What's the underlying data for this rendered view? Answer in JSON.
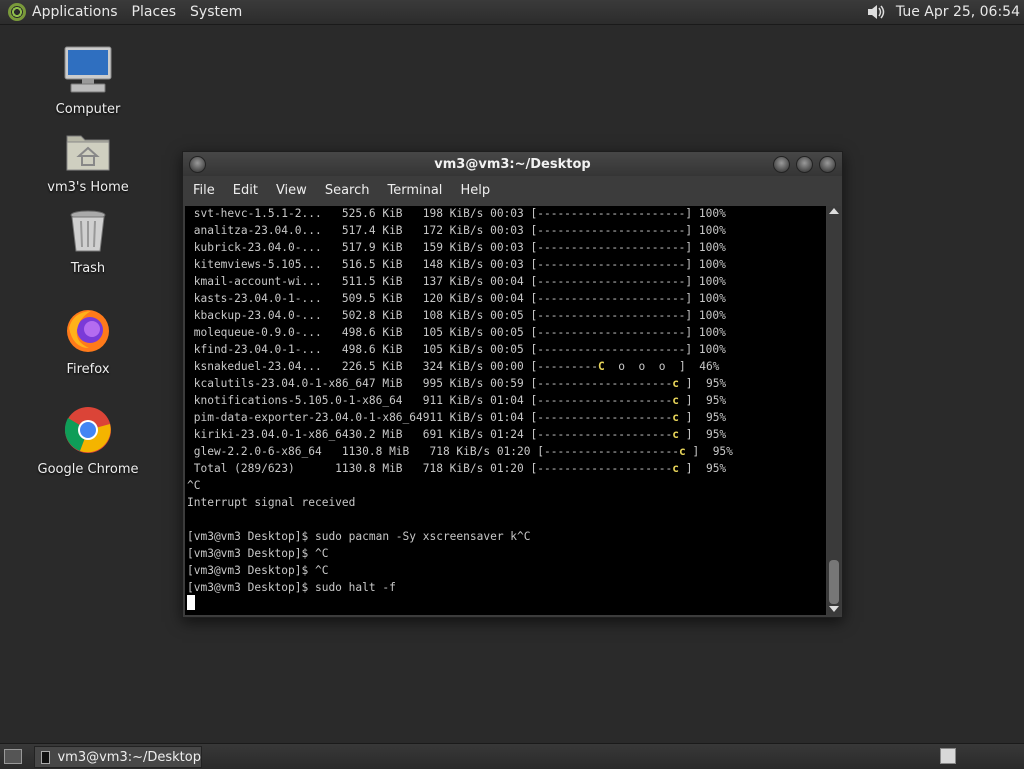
{
  "top_panel": {
    "menus": [
      "Applications",
      "Places",
      "System"
    ],
    "clock": "Tue Apr 25, 06:54",
    "icons": {
      "logo": "distro-logo-icon",
      "volume": "volume-icon"
    }
  },
  "desktop": {
    "icons": [
      {
        "label": "Computer",
        "icon": "computer-icon"
      },
      {
        "label": "vm3's Home",
        "icon": "home-folder-icon"
      },
      {
        "label": "Trash",
        "icon": "trash-icon"
      },
      {
        "label": "Firefox",
        "icon": "firefox-icon"
      },
      {
        "label": "Google Chrome",
        "icon": "chrome-icon"
      }
    ]
  },
  "window": {
    "title": "vm3@vm3:~/Desktop",
    "menu": [
      "File",
      "Edit",
      "View",
      "Search",
      "Terminal",
      "Help"
    ],
    "terminal": {
      "lines": [
        " svt-hevc-1.5.1-2...   525.6 KiB   198 KiB/s 00:03 [----------------------] 100%",
        " analitza-23.04.0...   517.4 KiB   172 KiB/s 00:03 [----------------------] 100%",
        " kubrick-23.04.0-...   517.9 KiB   159 KiB/s 00:03 [----------------------] 100%",
        " kitemviews-5.105...   516.5 KiB   148 KiB/s 00:03 [----------------------] 100%",
        " kmail-account-wi...   511.5 KiB   137 KiB/s 00:04 [----------------------] 100%",
        " kasts-23.04.0-1-...   509.5 KiB   120 KiB/s 00:04 [----------------------] 100%",
        " kbackup-23.04.0-...   502.8 KiB   108 KiB/s 00:05 [----------------------] 100%",
        " molequeue-0.9.0-...   498.6 KiB   105 KiB/s 00:05 [----------------------] 100%",
        " kfind-23.04.0-1-...   498.6 KiB   105 KiB/s 00:05 [----------------------] 100%",
        " ksnakeduel-23.04...   226.5 KiB   324 KiB/s 00:00 [---------C  o  o  o  ]  46%",
        " kcalutils-23.04.0-1-x86_647 MiB   995 KiB/s 00:59 [--------------------c ]  95%",
        " knotifications-5.105.0-1-x86_64   911 KiB/s 01:04 [--------------------c ]  95%",
        " pim-data-exporter-23.04.0-1-x86_64911 KiB/s 01:04 [--------------------c ]  95%",
        " kiriki-23.04.0-1-x86_6430.2 MiB   691 KiB/s 01:24 [--------------------c ]  95%",
        " glew-2.2.0-6-x86_64   1130.8 MiB   718 KiB/s 01:20 [--------------------c ]  95%",
        " Total (289/623)      1130.8 MiB   718 KiB/s 01:20 [--------------------c ]  95%",
        "^C",
        "Interrupt signal received",
        "",
        "[vm3@vm3 Desktop]$ sudo pacman -Sy xscreensaver k^C",
        "[vm3@vm3 Desktop]$ ^C",
        "[vm3@vm3 Desktop]$ ^C",
        "[vm3@vm3 Desktop]$ sudo halt -f"
      ]
    }
  },
  "bottom_panel": {
    "task_label": "vm3@vm3:~/Desktop",
    "icons": {
      "show_desktop": "show-desktop-icon",
      "terminal": "terminal-icon",
      "workspace": "workspace-switcher-icon"
    }
  }
}
